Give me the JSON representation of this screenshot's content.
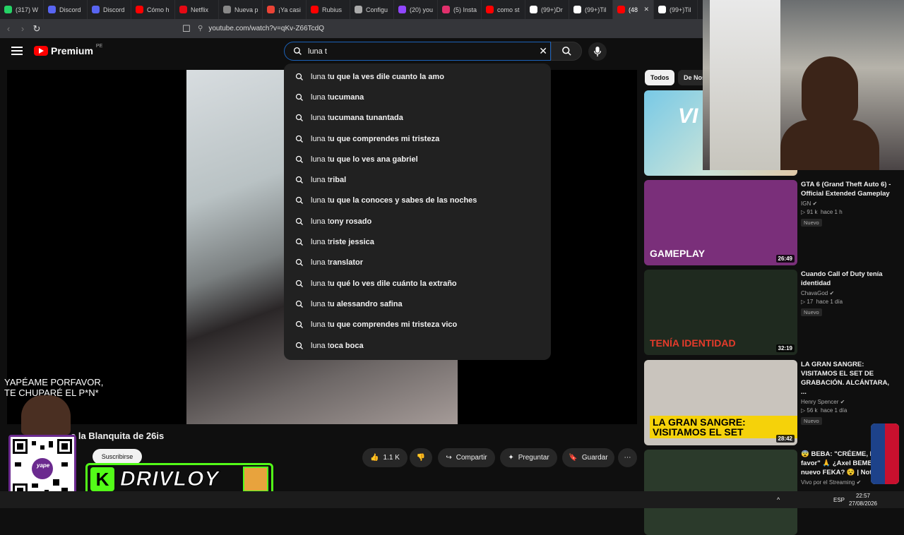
{
  "browser": {
    "tabs": [
      {
        "label": "(317) W",
        "icon_color": "#25d366"
      },
      {
        "label": "Discord",
        "icon_color": "#5865f2"
      },
      {
        "label": "Discord",
        "icon_color": "#5865f2"
      },
      {
        "label": "Cómo h",
        "icon_color": "#ff0000"
      },
      {
        "label": "Netflix",
        "icon_color": "#e50914"
      },
      {
        "label": "Nueva p",
        "icon_color": "#888888"
      },
      {
        "label": "¡Ya casi",
        "icon_color": "#ea4335"
      },
      {
        "label": "Rubius",
        "icon_color": "#ff0000"
      },
      {
        "label": "Configu",
        "icon_color": "#aaaaaa"
      },
      {
        "label": "(20) you",
        "icon_color": "#9146ff"
      },
      {
        "label": "(5) Insta",
        "icon_color": "#e1306c"
      },
      {
        "label": "como st",
        "icon_color": "#ff0000"
      },
      {
        "label": "(99+)Dr",
        "icon_color": "#ffffff"
      },
      {
        "label": "(99+)Til",
        "icon_color": "#ffffff"
      },
      {
        "label": "(48",
        "icon_color": "#ff0000"
      },
      {
        "label": "(99+)Til",
        "icon_color": "#ffffff"
      }
    ],
    "url": "youtube.com/watch?v=qKv-Z66TcdQ"
  },
  "youtube": {
    "logo": "Premium",
    "country": "PE",
    "search_value": "luna t",
    "suggestions": [
      {
        "prefix": "luna t",
        "rest": "u que la ves dile cuanto la amo"
      },
      {
        "prefix": "luna t",
        "rest": "ucumana"
      },
      {
        "prefix": "luna t",
        "rest": "ucumana tunantada"
      },
      {
        "prefix": "luna t",
        "rest": "u que comprendes mi tristeza"
      },
      {
        "prefix": "luna t",
        "rest": "u que lo ves ana gabriel"
      },
      {
        "prefix": "luna t",
        "rest": "ribal"
      },
      {
        "prefix": "luna t",
        "rest": "u que la conoces y sabes de las noches"
      },
      {
        "prefix": "luna t",
        "rest": "ony rosado"
      },
      {
        "prefix": "luna t",
        "rest": "riste jessica"
      },
      {
        "prefix": "luna t",
        "rest": "ranslator"
      },
      {
        "prefix": "luna t",
        "rest": "u qué lo ves dile cuánto la extraño"
      },
      {
        "prefix": "luna t",
        "rest": "u alessandro safina"
      },
      {
        "prefix": "luna t",
        "rest": "u que comprendes mi tristeza vico"
      },
      {
        "prefix": "luna t",
        "rest": "oca boca"
      }
    ],
    "video_title": "e la Blanquita de 26is",
    "subscribe": "Suscribirse",
    "actions": {
      "likes": "1.1 K",
      "share": "Compartir",
      "ask": "Preguntar",
      "save": "Guardar"
    },
    "chips": [
      "Todos",
      "De Nos"
    ],
    "recommendations": [
      {
        "title": "GTA 6 (Grand Theft Auto 6) - Official Extended Gameplay",
        "channel": "IGN",
        "views": "91 k",
        "age": "hace 1 h",
        "badge": "Nuevo",
        "duration": "26:49",
        "thumb_text": "GAMEPLAY",
        "thumb_color": "#7a2f7a"
      },
      {
        "title": "Cuando Call of Duty tenía identidad",
        "channel": "ChavaGod",
        "views": "17",
        "age": "hace 1 día",
        "badge": "Nuevo",
        "duration": "32:19",
        "thumb_text": "TENÍA IDENTIDAD",
        "thumb_color": "#1f2a1f"
      },
      {
        "title": "LA GRAN SANGRE: VISITAMOS EL SET DE GRABACIÓN. ALCÁNTARA, ...",
        "channel": "Henry Spencer",
        "views": "56 k",
        "age": "hace 1 día",
        "badge": "Nuevo",
        "duration": "28:42",
        "thumb_text": "LA GRAN SANGRE: VISITAMOS EL SET",
        "thumb_color": "#c9c4bd"
      },
      {
        "title": "😨 BEBA: \"CRÉEME, Po favor\" 🙏 ¿Axel BEMBA nuevo FEKA? 😵 | Notic",
        "channel": "Vivo por el Streaming",
        "views": "",
        "age": "",
        "badge": "",
        "duration": "",
        "thumb_text": "",
        "thumb_color": "#2b3a2b"
      }
    ]
  },
  "overlay": {
    "text_line1": "YAPÉAME PORFAVOR,",
    "text_line2": "TE CHUPARÉ  EL P*N*",
    "qr_label": "yape",
    "kick_name": "DRIVLOY"
  },
  "taskbar": {
    "lang": "ESP",
    "time": "22:57",
    "date": "27/08/2026"
  }
}
